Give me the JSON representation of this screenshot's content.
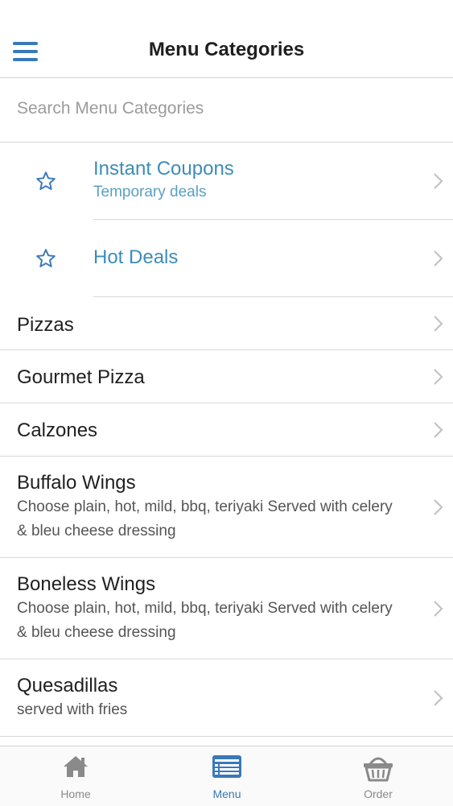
{
  "header": {
    "title": "Menu Categories",
    "menu_icon": "hamburger-icon"
  },
  "search": {
    "placeholder": "Search Menu Categories",
    "value": ""
  },
  "favorites": [
    {
      "title": "Instant Coupons",
      "subtitle": "Temporary deals",
      "icon": "star-outline-icon"
    },
    {
      "title": "Hot Deals",
      "subtitle": "",
      "icon": "star-outline-icon"
    }
  ],
  "categories": [
    {
      "title": "Pizzas",
      "subtitle": ""
    },
    {
      "title": "Gourmet Pizza",
      "subtitle": ""
    },
    {
      "title": "Calzones",
      "subtitle": ""
    },
    {
      "title": "Buffalo Wings",
      "subtitle": "Choose plain, hot, mild, bbq, teriyaki Served with celery & bleu cheese dressing"
    },
    {
      "title": "Boneless Wings",
      "subtitle": "Choose plain, hot, mild, bbq, teriyaki Served with celery & bleu cheese dressing"
    },
    {
      "title": "Quesadillas",
      "subtitle": "served with fries"
    }
  ],
  "tabs": [
    {
      "label": "Home",
      "icon": "home-icon",
      "active": false
    },
    {
      "label": "Menu",
      "icon": "menu-list-icon",
      "active": true
    },
    {
      "label": "Order",
      "icon": "basket-icon",
      "active": false
    }
  ],
  "colors": {
    "accent": "#3a79b7",
    "favorite_text": "#3d8db8",
    "divider": "#d9d9d9",
    "inactive_tab": "#8a8a8a"
  }
}
